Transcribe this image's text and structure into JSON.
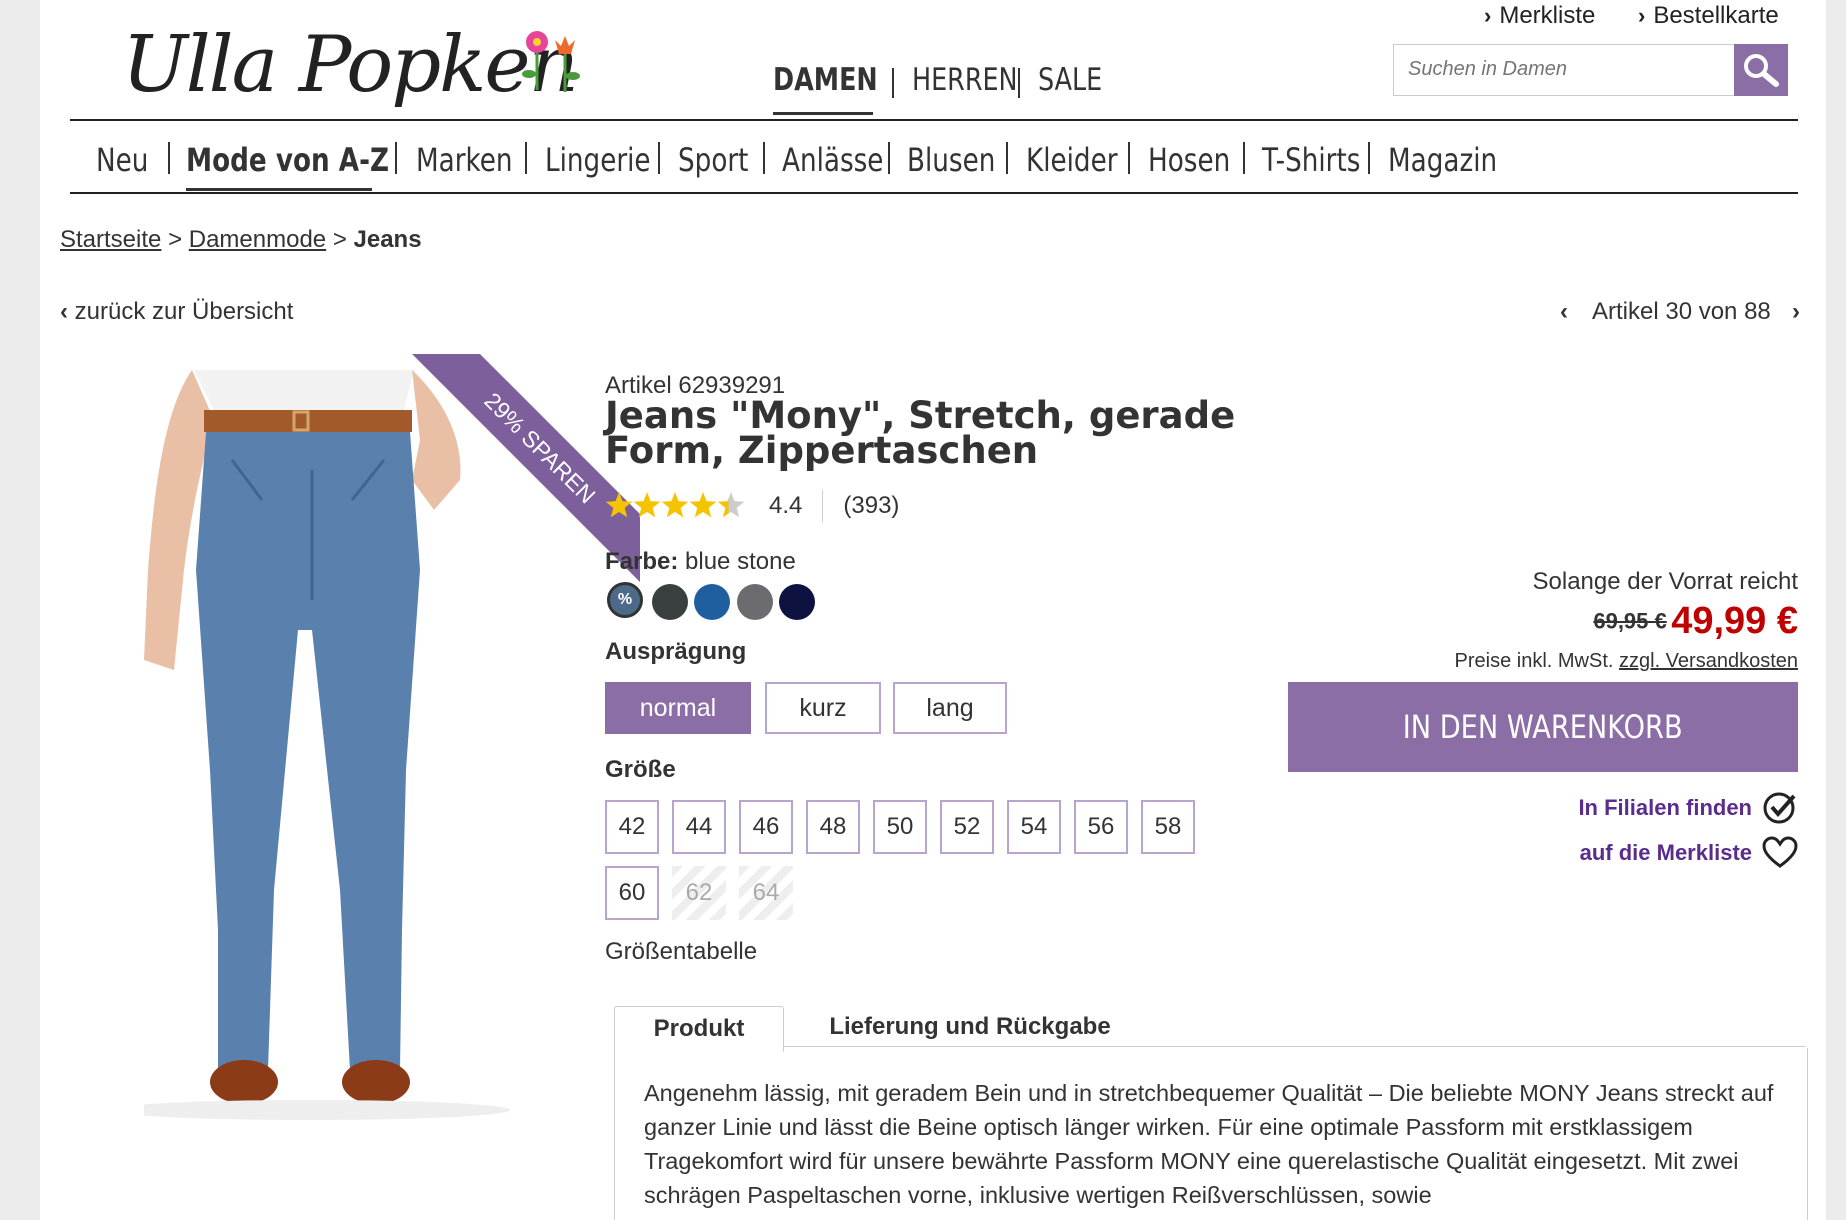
{
  "header": {
    "logo_text": "Ulla Popken",
    "top_links": [
      "Merkliste",
      "Bestellkarte"
    ],
    "gender_nav": [
      "DAMEN",
      "HERREN",
      "SALE"
    ],
    "search": {
      "placeholder": "Suchen in Damen",
      "button_icon": "search-icon"
    }
  },
  "category_nav": [
    "Neu",
    "Mode von A-Z",
    "Marken",
    "Lingerie",
    "Sport",
    "Anlässe",
    "Blusen",
    "Kleider",
    "Hosen",
    "T-Shirts",
    "Magazin"
  ],
  "breadcrumb": {
    "items": [
      "Startseite",
      "Damenmode"
    ],
    "current": "Jeans",
    "sep": ">"
  },
  "nav": {
    "back": "zurück zur Übersicht",
    "article_counter": "Artikel 30 von 88"
  },
  "product": {
    "badge": "29% SPAREN",
    "article_number": "Artikel 62939291",
    "title": "Jeans \"Mony\", Stretch, gerade Form, Zippertaschen",
    "rating": "4.4",
    "rating_value": 4.4,
    "review_count": "(393)",
    "color_label": "Farbe:",
    "color_value": "blue stone",
    "swatch_sale_mark": "%",
    "variant_label": "Ausprägung",
    "variants": [
      "normal",
      "kurz",
      "lang"
    ],
    "size_label": "Größe",
    "sizes": [
      "42",
      "44",
      "46",
      "48",
      "50",
      "52",
      "54",
      "56",
      "58",
      "60",
      "62",
      "64"
    ],
    "size_table": "Größentabelle"
  },
  "buybox": {
    "availability": "Solange der Vorrat reicht",
    "old_price": "69,95 €",
    "price": "49,99 €",
    "tax_note": "Preise inkl. MwSt.",
    "shipping_link": "zzgl. Versandkosten",
    "cart_button": "IN DEN WARENKORB",
    "store_link": "In Filialen finden",
    "wishlist_link": "auf die Merkliste"
  },
  "tabs": [
    "Produkt",
    "Lieferung und Rückgabe"
  ],
  "description": "Angenehm lässig, mit geradem Bein und in stretchbequemer Qualität – Die beliebte MONY Jeans streckt auf ganzer Linie und lässt die Beine optisch länger wirken. Für eine optimale Passform mit erstklassigem Tragekomfort wird für unsere bewährte Passform MONY eine querelastische Qualität eingesetzt. Mit zwei schrägen Paspeltaschen vorne, inklusive wertigen Reißverschlüssen, sowie",
  "colors": {
    "accent": "#8c6ea6",
    "price_red": "#c00000",
    "link_purple": "#5a2d8c",
    "star": "#f5c400"
  }
}
